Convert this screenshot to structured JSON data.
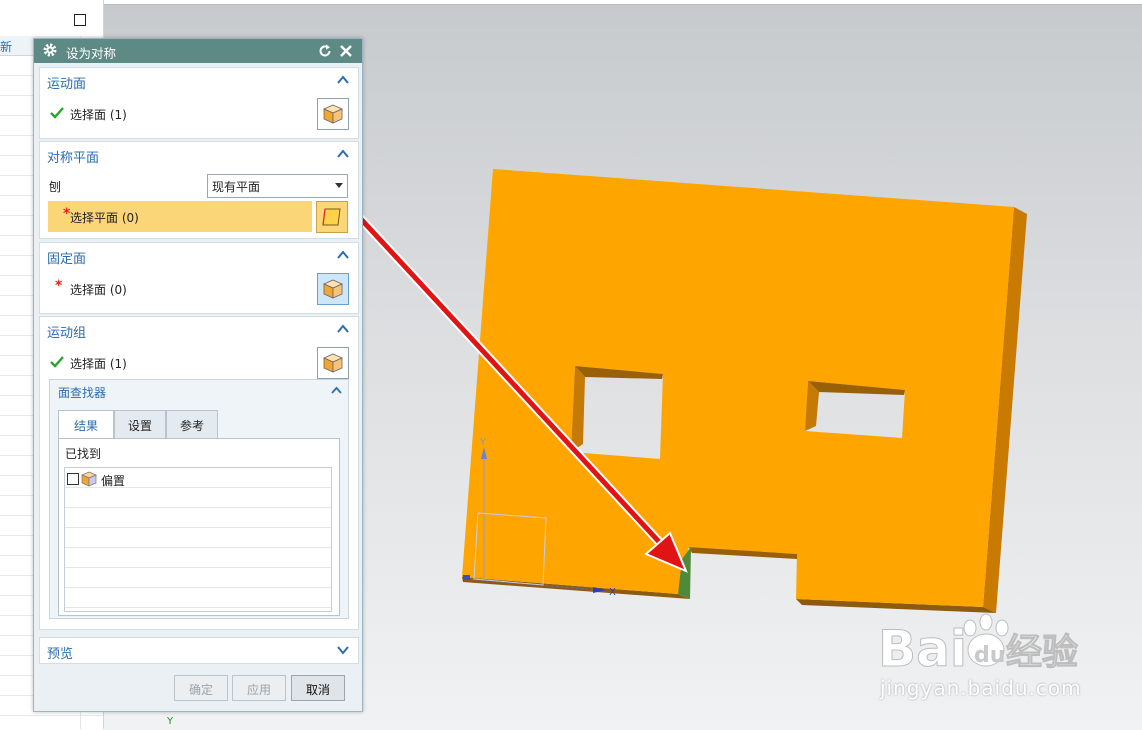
{
  "navigator": {
    "header_fragment": "新"
  },
  "dialog": {
    "title": "设为对称",
    "sections": {
      "motion_face": {
        "title": "运动面",
        "select_label": "选择面 (1)"
      },
      "symmetry_plane": {
        "title": "对称平面",
        "create_label": "刨",
        "dropdown_value": "现有平面",
        "select_label": "选择平面 (0)"
      },
      "fixed_face": {
        "title": "固定面",
        "select_label": "选择面 (0)"
      },
      "motion_group": {
        "title": "运动组",
        "select_label": "选择面 (1)",
        "face_finder": {
          "title": "面查找器",
          "tabs": [
            "结果",
            "设置",
            "参考"
          ],
          "found_label": "已找到",
          "items": [
            "偏置"
          ]
        }
      },
      "preview": {
        "title": "预览"
      }
    },
    "buttons": {
      "ok": "确定",
      "apply": "应用",
      "cancel": "取消"
    }
  },
  "viewport": {
    "part_color": "#FFA500",
    "part_side_color": "#C97A00",
    "selected_face_color": "#4E8A3A",
    "axis_labels": {
      "y": "Y",
      "x": "X",
      "y_bottom": "Y"
    }
  },
  "watermark": {
    "brand_text": "Bai",
    "brand_text2": "du",
    "brand_cn": "经验",
    "url": "jingyan.baidu.com"
  }
}
